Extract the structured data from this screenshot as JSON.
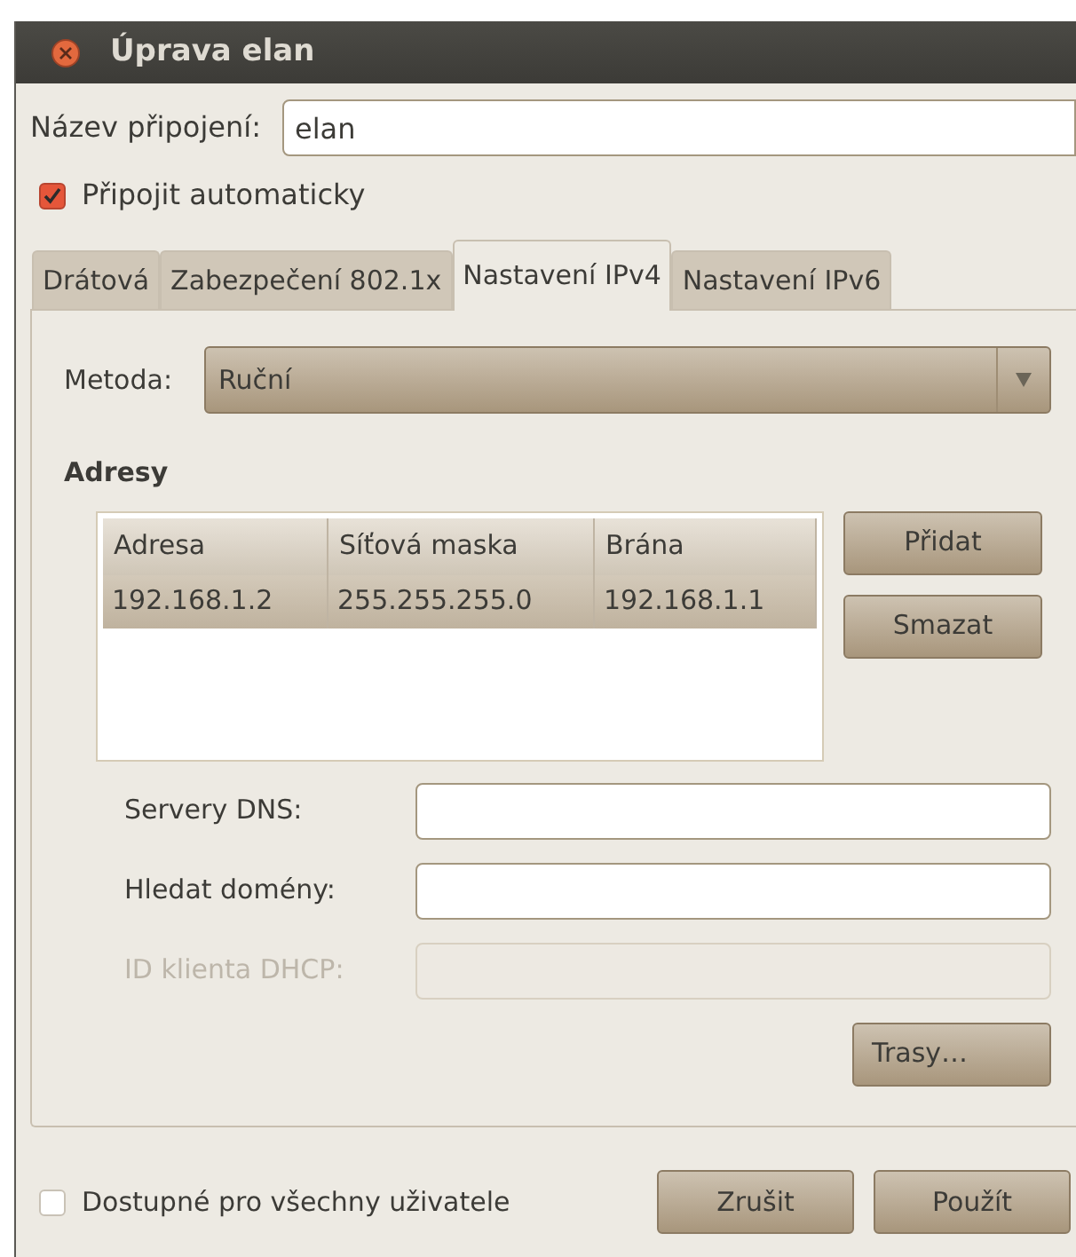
{
  "window": {
    "title": "Úprava elan"
  },
  "connection_name": {
    "label": "Název připojení:",
    "value": "elan"
  },
  "auto_connect": {
    "label": "Připojit automaticky",
    "checked": true
  },
  "tabs": [
    {
      "label": "Drátová",
      "selected": false
    },
    {
      "label": "Zabezpečení 802.1x",
      "selected": false
    },
    {
      "label": "Nastavení IPv4",
      "selected": true
    },
    {
      "label": "Nastavení IPv6",
      "selected": false
    }
  ],
  "method": {
    "label": "Metoda:",
    "value": "Ruční"
  },
  "addresses": {
    "title": "Adresy",
    "columns": [
      "Adresa",
      "Síťová maska",
      "Brána"
    ],
    "rows": [
      {
        "cells": [
          "192.168.1.2",
          "255.255.255.0",
          "192.168.1.1"
        ],
        "selected": true
      }
    ],
    "buttons": [
      "Přidat",
      "Smazat"
    ]
  },
  "fields": [
    {
      "label": "Servery DNS:",
      "disabled": false
    },
    {
      "label": "Hledat domény:",
      "disabled": false
    },
    {
      "label": "ID klienta DHCP:",
      "disabled": true
    }
  ],
  "routes_button": "Trasy…",
  "available_all": {
    "label": "Dostupné pro všechny uživatele",
    "checked": false
  },
  "dialog_buttons": [
    "Zrušit",
    "Použít"
  ]
}
